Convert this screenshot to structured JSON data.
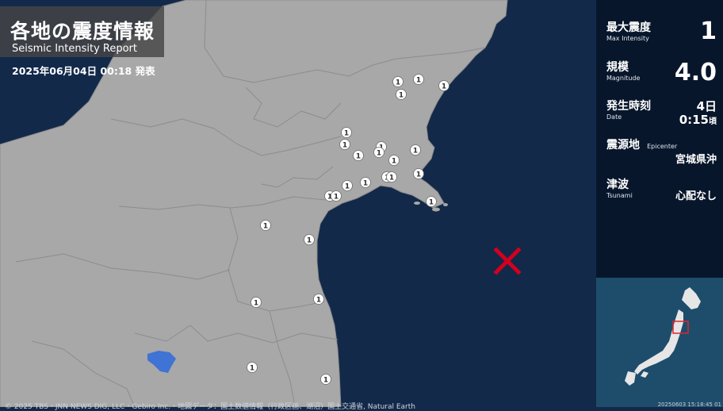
{
  "header": {
    "title": "各地の震度情報",
    "subtitle": "Seismic Intensity Report",
    "announcement": "2025年06月04日 00:18 発表"
  },
  "panel": {
    "max_intensity": {
      "label_jp": "最大震度",
      "label_en": "Max Intensity",
      "value": "1"
    },
    "magnitude": {
      "label_jp": "規模",
      "label_en": "Magnitude",
      "value": "4.0"
    },
    "date": {
      "label_jp": "発生時刻",
      "label_en": "Date",
      "day": "4日",
      "time": "0:15",
      "suffix": "頃"
    },
    "epicenter": {
      "label_jp": "震源地",
      "label_en": "Epicenter",
      "value": "宮城県沖"
    },
    "tsunami": {
      "label_jp": "津波",
      "label_en": "Tsunami",
      "value": "心配なし"
    }
  },
  "map": {
    "station_intensity_label": "1",
    "epicenter_marker": "×",
    "colors": {
      "sea": "#12294a",
      "land": "#a8a8a8",
      "border": "#8c8c8c",
      "lake": "#3f73d4",
      "epicenter": "#d2001f"
    }
  },
  "credit": "© 2025 TBS・JNN NEWS DIG, LLC・Gebiro Inc.・地図データ：国土数値情報（行政区画、湖沼）国土交通省, Natural Earth",
  "inset": {
    "timestamp": "20250603 15:18:45 01"
  }
}
